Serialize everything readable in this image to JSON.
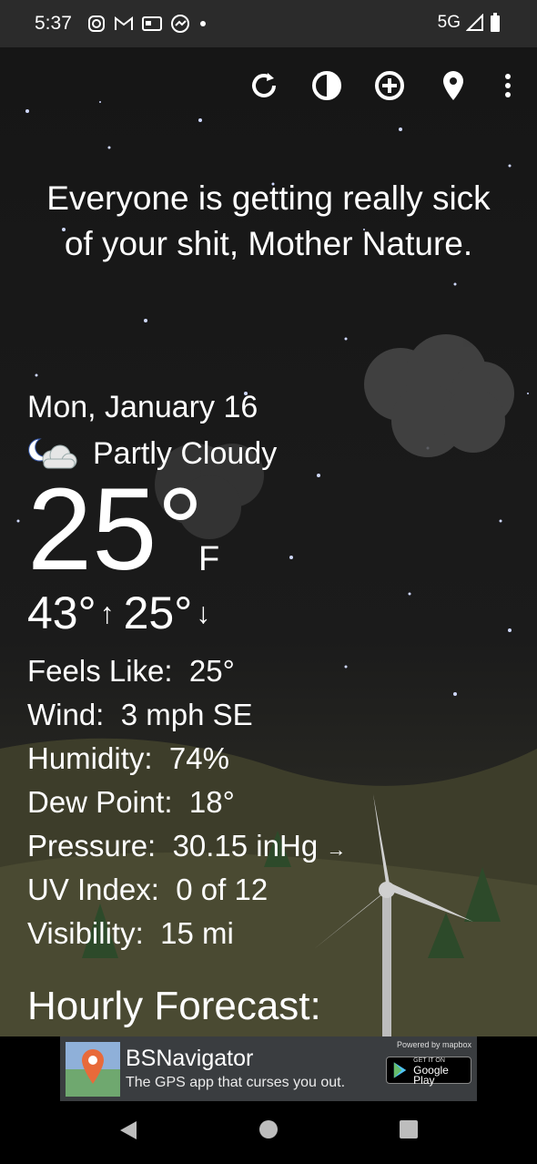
{
  "status_bar": {
    "time": "5:37",
    "network": "5G",
    "app_icons": [
      "instagram-icon",
      "gmail-icon",
      "news-icon",
      "messenger-icon",
      "dot-icon"
    ]
  },
  "toolbar": {
    "buttons": [
      "refresh-icon",
      "theme-toggle-icon",
      "add-location-icon",
      "location-pin-icon",
      "more-options-icon"
    ]
  },
  "weather": {
    "phrase": "Everyone is getting really sick of your shit, Mother Nature.",
    "date": "Mon, January 16",
    "condition": "Partly Cloudy",
    "temperature": "25°",
    "unit": "F",
    "high": "43°",
    "low": "25°",
    "details": [
      {
        "label": "Feels Like:",
        "value": "25°"
      },
      {
        "label": "Wind:",
        "value": "3 mph SE"
      },
      {
        "label": "Humidity:",
        "value": "74%"
      },
      {
        "label": "Dew Point:",
        "value": "18°"
      },
      {
        "label": "Pressure:",
        "value": "30.15 inHg",
        "trend": "→"
      },
      {
        "label": "UV Index:",
        "value": "0 of 12"
      },
      {
        "label": "Visibility:",
        "value": "15 mi"
      }
    ],
    "hourly_title": "Hourly Forecast:"
  },
  "ad": {
    "app_name": "BSNavigator",
    "tagline": "The GPS app that curses you out.",
    "powered_by": "Powered by mapbox",
    "store_pre": "GET IT ON",
    "store_name": "Google Play"
  },
  "colors": {
    "sky": "#1a1a1a",
    "status_bar": "#2b2b2b",
    "cloud": "#4a4a4a",
    "ground": "#3a3a2c"
  }
}
